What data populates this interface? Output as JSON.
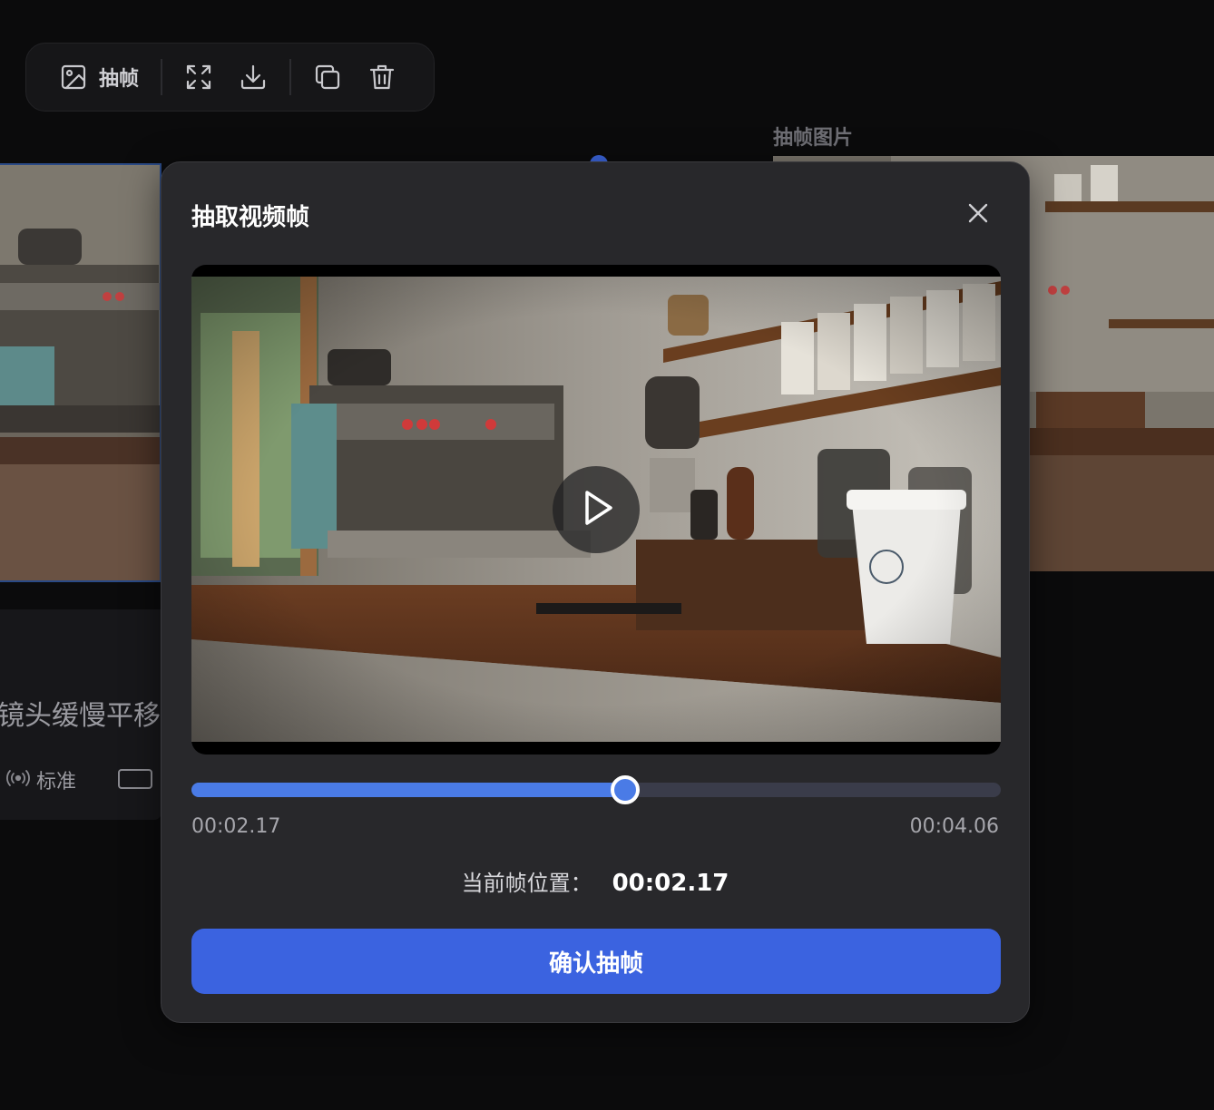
{
  "toolbar": {
    "extract_label": "抽帧",
    "icons": [
      "image-icon",
      "fullscreen-icon",
      "download-icon",
      "copy-icon",
      "trash-icon"
    ]
  },
  "background": {
    "right_title": "抽帧图片",
    "left_description": "镜头缓慢平移拍",
    "left_quality": "标准"
  },
  "modal": {
    "title": "抽取视频帧",
    "close_icon": "close-icon",
    "play_icon": "play-icon",
    "time_start": "00:02.17",
    "time_end": "00:04.06",
    "progress": 0.536,
    "current_label": "当前帧位置：",
    "current_value": "00:02.17",
    "confirm_label": "确认抽帧"
  },
  "colors": {
    "accent": "#3b63e0",
    "slider_fill": "#4a7be6",
    "modal_bg": "#28282b",
    "page_bg": "#0b0b0c"
  }
}
